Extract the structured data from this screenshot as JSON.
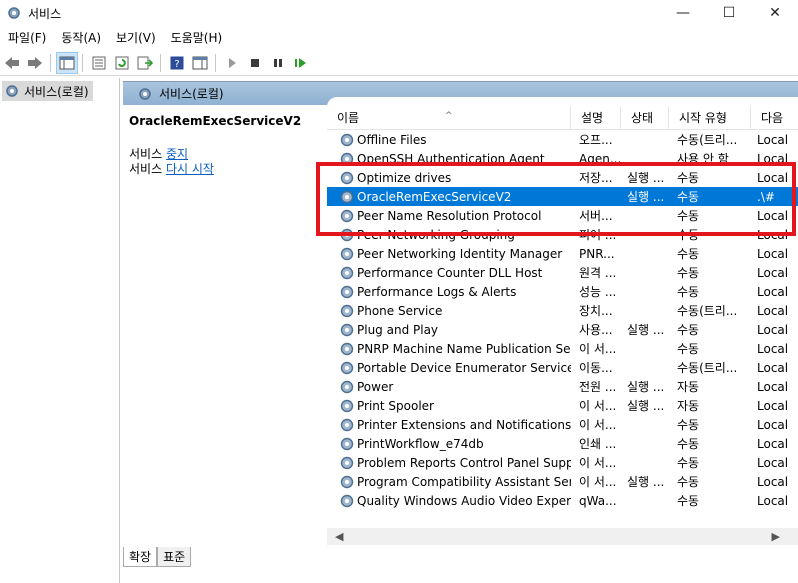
{
  "window": {
    "title": "서비스",
    "minimize": "—",
    "maximize": "☐",
    "close": "✕"
  },
  "menu": [
    "파일(F)",
    "동작(A)",
    "보기(V)",
    "도움말(H)"
  ],
  "tree": {
    "root": "서비스(로컬)"
  },
  "pane": {
    "header": "서비스(로컬)"
  },
  "details": {
    "service_name": "OracleRemExecServiceV2",
    "stop_prefix": "서비스 ",
    "stop_link": "중지",
    "restart_prefix": "서비스 ",
    "restart_link": "다시 시작"
  },
  "columns": [
    "이름",
    "설명",
    "상태",
    "시작 유형",
    "다음"
  ],
  "services": [
    {
      "name": "Offline Files",
      "desc": "오프...",
      "state": "",
      "start": "수동(트리...",
      "logon": "Local"
    },
    {
      "name": "OpenSSH Authentication Agent",
      "desc": "Agen...",
      "state": "",
      "start": "사용 안 함",
      "logon": "Local"
    },
    {
      "name": "Optimize drives",
      "desc": "저장...",
      "state": "실행 ...",
      "start": "수동",
      "logon": "Local"
    },
    {
      "name": "OracleRemExecServiceV2",
      "desc": "",
      "state": "실행 ...",
      "start": "수동",
      "logon": ".\\#"
    },
    {
      "name": "Peer Name Resolution Protocol",
      "desc": "서버...",
      "state": "",
      "start": "수동",
      "logon": "Local"
    },
    {
      "name": "Peer Networking Grouping",
      "desc": "피어 ...",
      "state": "",
      "start": "수동",
      "logon": "Local"
    },
    {
      "name": "Peer Networking Identity Manager",
      "desc": "PNR...",
      "state": "",
      "start": "수동",
      "logon": "Local"
    },
    {
      "name": "Performance Counter DLL Host",
      "desc": "원격 ...",
      "state": "",
      "start": "수동",
      "logon": "Local"
    },
    {
      "name": "Performance Logs & Alerts",
      "desc": "성능 ...",
      "state": "",
      "start": "수동",
      "logon": "Local"
    },
    {
      "name": "Phone Service",
      "desc": "장치...",
      "state": "",
      "start": "수동(트리...",
      "logon": "Local"
    },
    {
      "name": "Plug and Play",
      "desc": "사용...",
      "state": "실행 ...",
      "start": "수동",
      "logon": "Local"
    },
    {
      "name": "PNRP Machine Name Publication Ser...",
      "desc": "이 서...",
      "state": "",
      "start": "수동",
      "logon": "Local"
    },
    {
      "name": "Portable Device Enumerator Service",
      "desc": "이동...",
      "state": "",
      "start": "수동(트리...",
      "logon": "Local"
    },
    {
      "name": "Power",
      "desc": "전원 ...",
      "state": "실행 ...",
      "start": "자동",
      "logon": "Local"
    },
    {
      "name": "Print Spooler",
      "desc": "이 서...",
      "state": "실행 ...",
      "start": "자동",
      "logon": "Local"
    },
    {
      "name": "Printer Extensions and Notifications",
      "desc": "이 서...",
      "state": "",
      "start": "수동",
      "logon": "Local"
    },
    {
      "name": "PrintWorkflow_e74db",
      "desc": "인쇄 ...",
      "state": "",
      "start": "수동",
      "logon": "Local"
    },
    {
      "name": "Problem Reports Control Panel Support",
      "desc": "이 서...",
      "state": "",
      "start": "수동",
      "logon": "Local"
    },
    {
      "name": "Program Compatibility Assistant Servi...",
      "desc": "이 서...",
      "state": "실행 ...",
      "start": "수동",
      "logon": "Local"
    },
    {
      "name": "Quality Windows Audio Video Experie...",
      "desc": "qWa...",
      "state": "",
      "start": "수동",
      "logon": "Local"
    }
  ],
  "tabs": [
    "확장",
    "표준"
  ],
  "colors": {
    "selection": "#0078d7",
    "highlight_box": "#e3161e",
    "header_bar": "#a9c4de"
  }
}
